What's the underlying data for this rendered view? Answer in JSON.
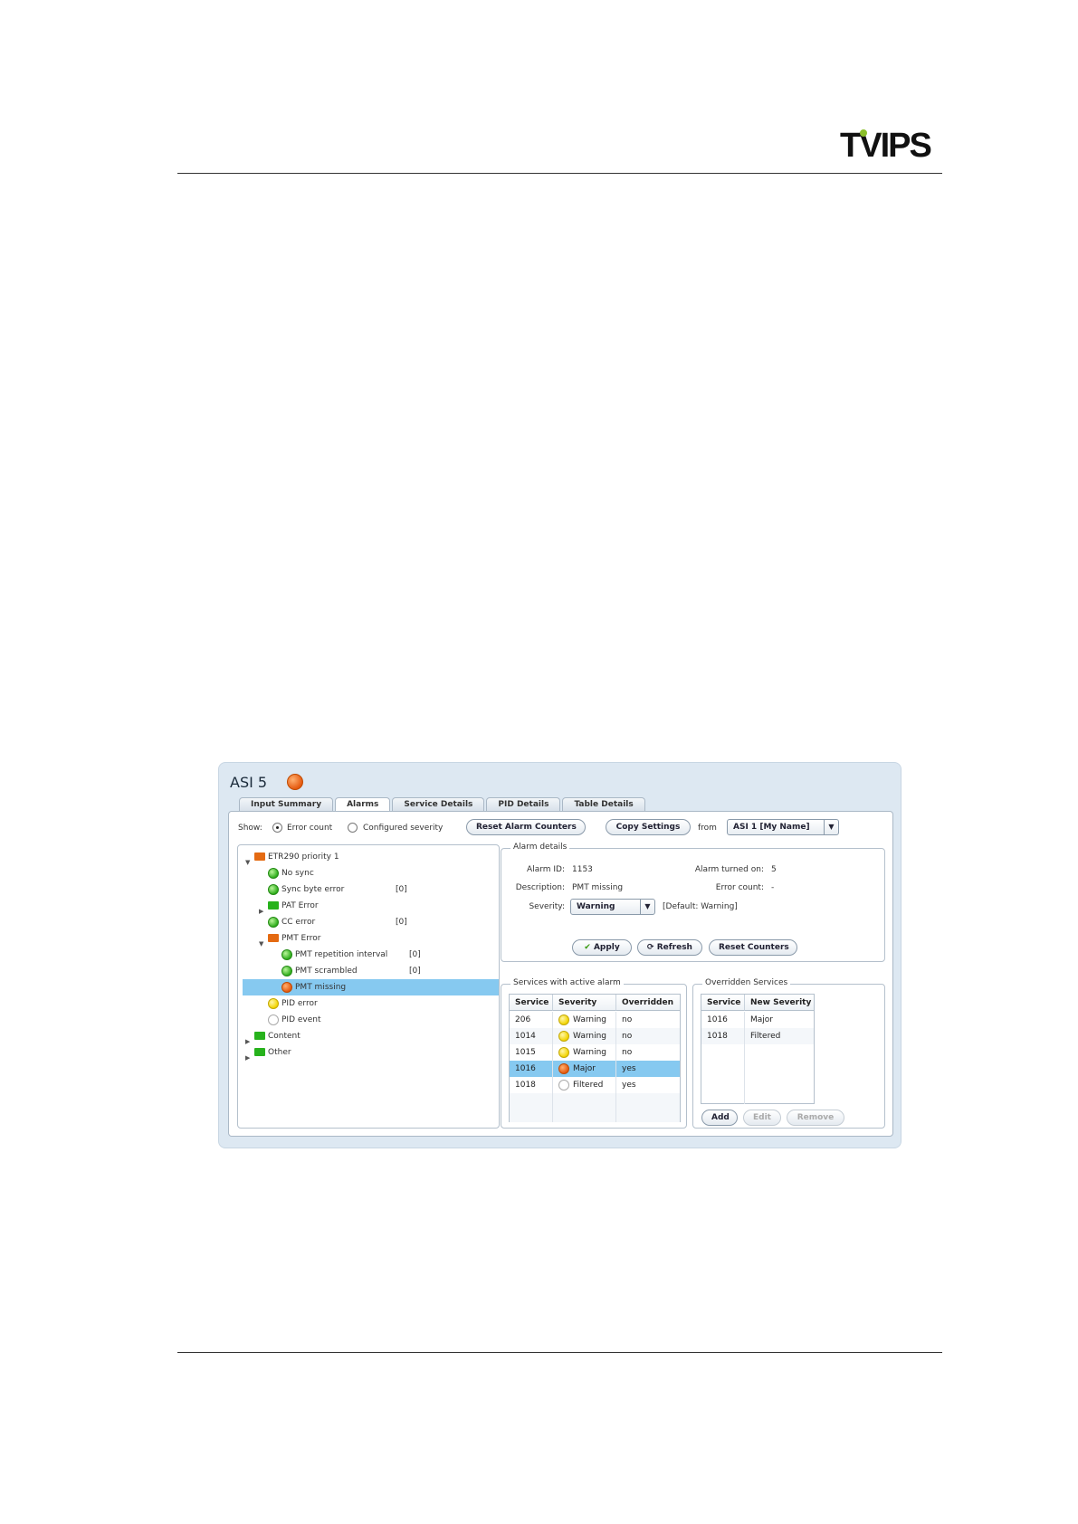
{
  "page": {
    "logo_text": "TVIPS"
  },
  "window": {
    "title": "ASI 5"
  },
  "tabs": [
    "Input Summary",
    "Alarms",
    "Service Details",
    "PID Details",
    "Table Details"
  ],
  "toolbar": {
    "show_label": "Show:",
    "radio_error_count": "Error count",
    "radio_configured_severity": "Configured severity",
    "reset_alarm_counters": "Reset Alarm Counters",
    "copy_settings": "Copy Settings",
    "from_label": "from",
    "source_select": "ASI 1 [My Name]"
  },
  "tree": [
    {
      "label": "ETR290 priority 1",
      "count": ""
    },
    {
      "label": "No sync",
      "count": ""
    },
    {
      "label": "Sync byte error",
      "count": "[0]"
    },
    {
      "label": "PAT Error",
      "count": ""
    },
    {
      "label": "CC error",
      "count": "[0]"
    },
    {
      "label": "PMT Error",
      "count": ""
    },
    {
      "label": "PMT repetition interval",
      "count": "[0]"
    },
    {
      "label": "PMT scrambled",
      "count": "[0]"
    },
    {
      "label": "PMT missing",
      "count": ""
    },
    {
      "label": "PID error",
      "count": ""
    },
    {
      "label": "PID event",
      "count": ""
    },
    {
      "label": "Content",
      "count": ""
    },
    {
      "label": "Other",
      "count": ""
    }
  ],
  "alarm_details": {
    "title": "Alarm details",
    "alarm_id_label": "Alarm ID:",
    "alarm_id": "1153",
    "turned_on_label": "Alarm turned on:",
    "turned_on": "5",
    "description_label": "Description:",
    "description": "PMT missing",
    "error_count_label": "Error count:",
    "error_count": "-",
    "severity_label": "Severity:",
    "severity": "Warning",
    "default_note": "[Default: Warning]",
    "apply": "Apply",
    "refresh": "Refresh",
    "reset_counters": "Reset Counters"
  },
  "active_services": {
    "title": "Services with active alarm",
    "columns": [
      "Service",
      "Severity",
      "Overridden"
    ],
    "rows": [
      {
        "service": "206",
        "severity": "Warning",
        "overridden": "no"
      },
      {
        "service": "1014",
        "severity": "Warning",
        "overridden": "no"
      },
      {
        "service": "1015",
        "severity": "Warning",
        "overridden": "no"
      },
      {
        "service": "1016",
        "severity": "Major",
        "overridden": "yes"
      },
      {
        "service": "1018",
        "severity": "Filtered",
        "overridden": "yes"
      }
    ]
  },
  "overridden_services": {
    "title": "Overridden Services",
    "columns": [
      "Service",
      "New Severity"
    ],
    "rows": [
      {
        "service": "1016",
        "severity": "Major"
      },
      {
        "service": "1018",
        "severity": "Filtered"
      }
    ],
    "add": "Add",
    "edit": "Edit",
    "remove": "Remove"
  },
  "colors": {
    "selection": "#86c9f0",
    "ok": "#2fae1c",
    "major": "#e55a10",
    "warning": "#f2d400"
  }
}
